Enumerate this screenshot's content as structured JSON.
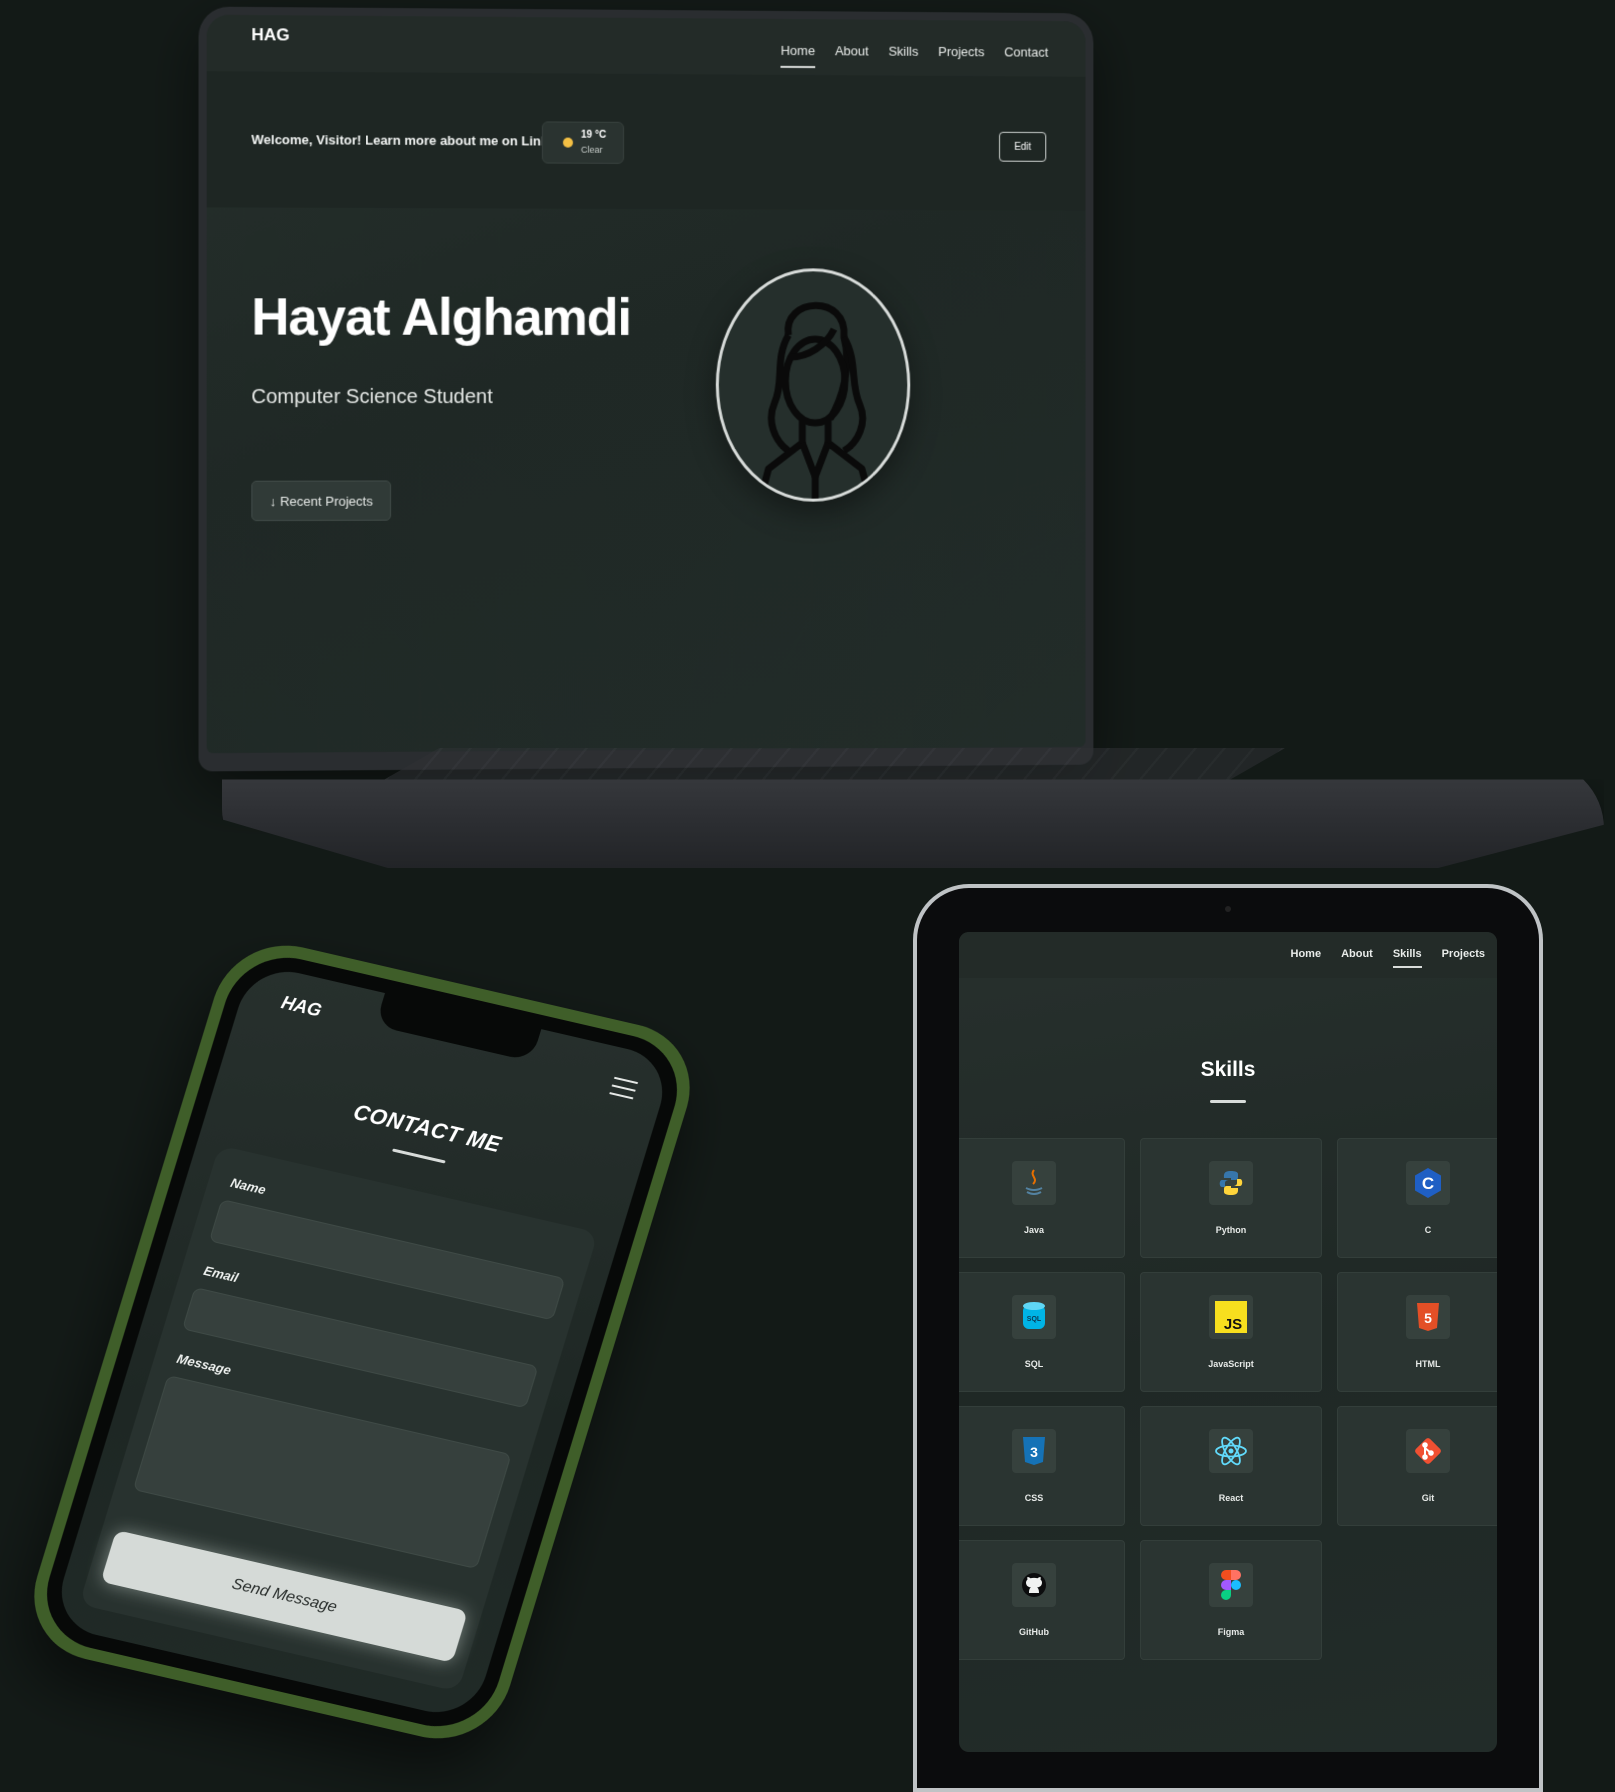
{
  "laptop": {
    "logo": "HAG",
    "nav": [
      "Home",
      "About",
      "Skills",
      "Projects",
      "Contact"
    ],
    "welcome": "Welcome, Visitor! Learn more about me on LinkedIn",
    "weather": {
      "temp": "19 °C",
      "cond": "Clear"
    },
    "edit_label": "Edit",
    "name": "Hayat Alghamdi",
    "role": "Computer Science Student",
    "cta": "↓ Recent Projects"
  },
  "phone": {
    "logo": "HAG",
    "title": "CONTACT ME",
    "labels": {
      "name": "Name",
      "email": "Email",
      "message": "Message"
    },
    "send": "Send Message"
  },
  "tablet": {
    "nav": [
      "Home",
      "About",
      "Skills",
      "Projects"
    ],
    "title": "Skills",
    "skills": [
      "Java",
      "Python",
      "C",
      "SQL",
      "JavaScript",
      "HTML",
      "CSS",
      "React",
      "Git",
      "GitHub",
      "Figma"
    ]
  },
  "colors": {
    "background": "#131a17",
    "phone_frame": "#3f5e29",
    "screen": "#1f2825"
  }
}
